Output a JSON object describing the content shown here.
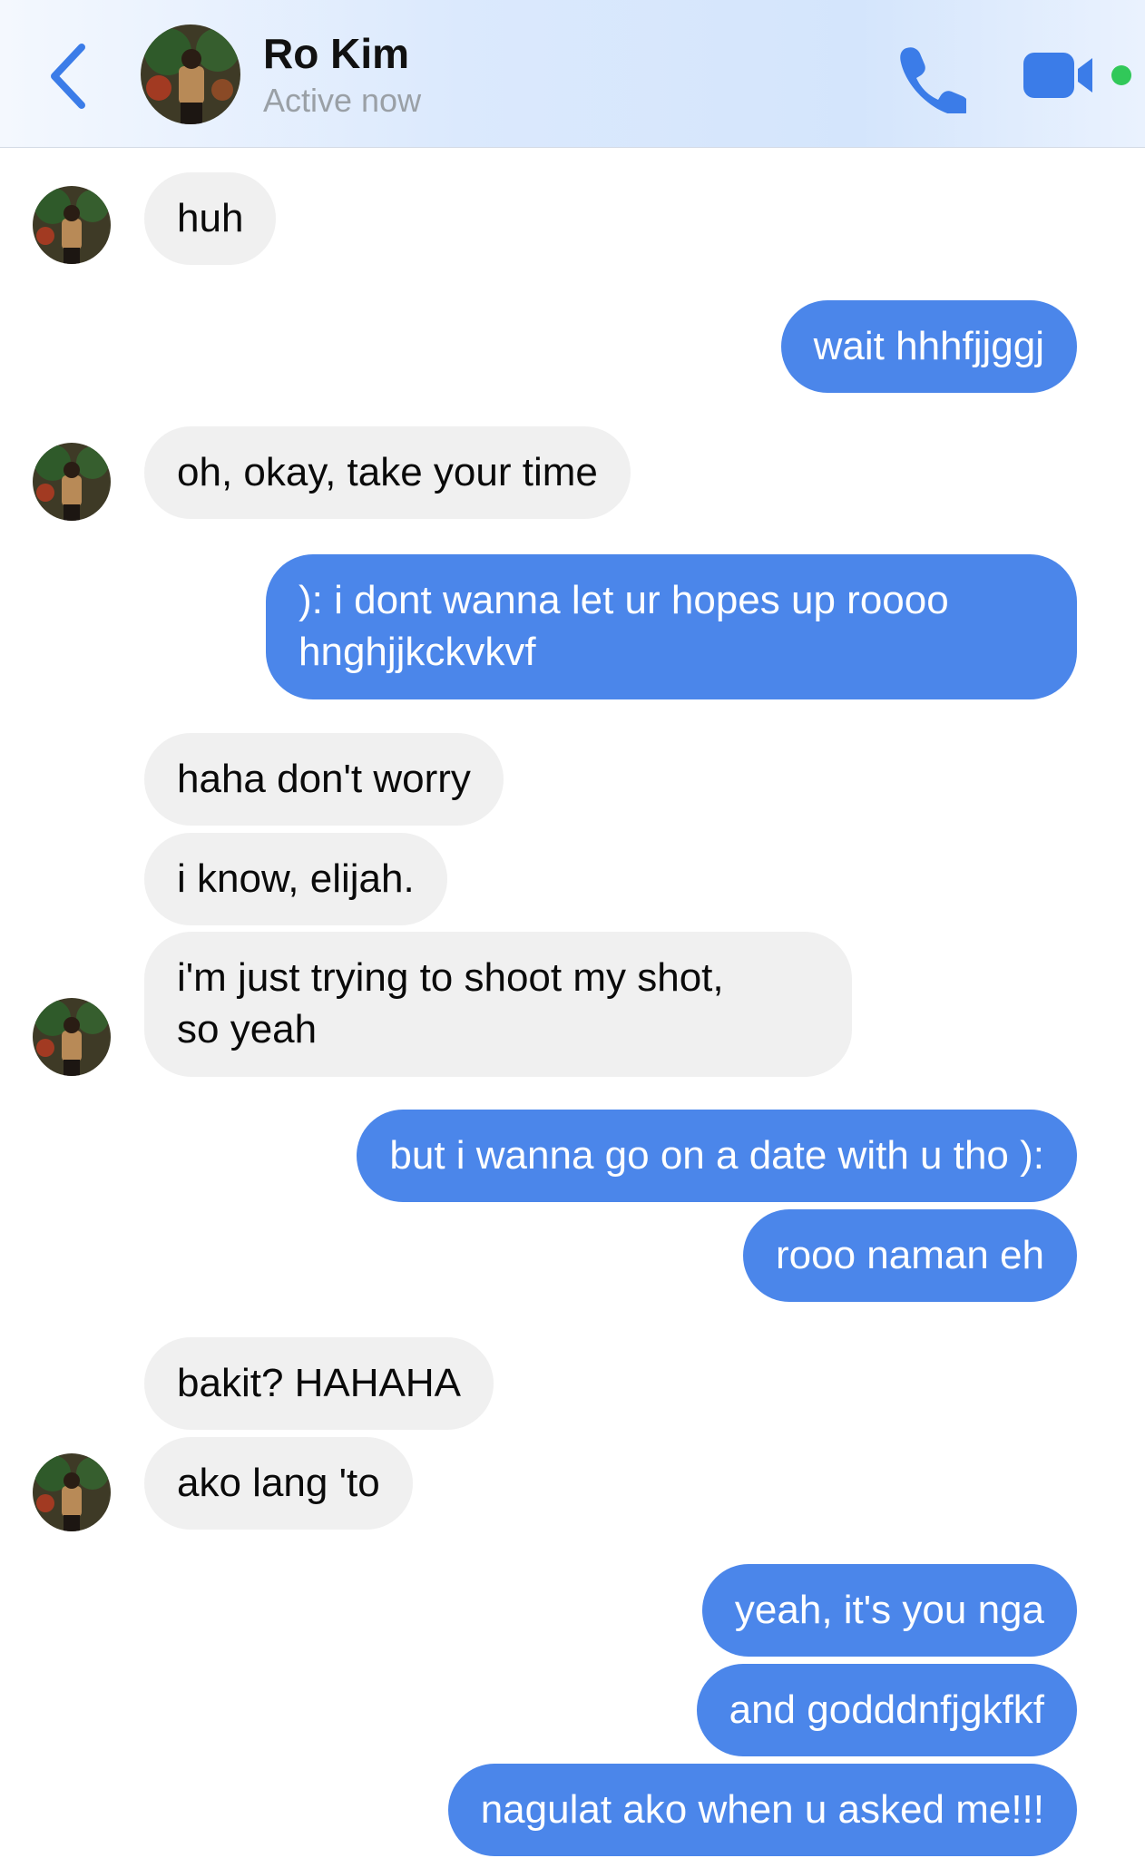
{
  "header": {
    "contact_name": "Ro Kim",
    "status": "Active now",
    "icons": [
      "back-chevron-icon",
      "avatar",
      "phone-icon",
      "video-camera-icon",
      "online-dot"
    ],
    "colors": {
      "accent": "#4b86ea",
      "online": "#31c859"
    }
  },
  "messages": [
    {
      "from": "them",
      "lines": [
        "huh"
      ]
    },
    {
      "from": "me",
      "lines": [
        "wait hhhfjjggj"
      ]
    },
    {
      "from": "them",
      "lines": [
        "oh, okay, take your time"
      ]
    },
    {
      "from": "me",
      "lines": [
        "): i dont wanna let ur hopes up roooo",
        "hnghjjkckvkvf"
      ]
    },
    {
      "from": "them",
      "lines": [
        "haha don't worry"
      ]
    },
    {
      "from": "them",
      "lines": [
        "i know, elijah."
      ]
    },
    {
      "from": "them",
      "lines": [
        "i'm just trying to shoot my shot,",
        "so yeah"
      ]
    },
    {
      "from": "me",
      "lines": [
        "but i wanna go on a date with u tho ):"
      ]
    },
    {
      "from": "me",
      "lines": [
        "rooo naman eh"
      ]
    },
    {
      "from": "them",
      "lines": [
        "bakit? HAHAHA"
      ]
    },
    {
      "from": "them",
      "lines": [
        "ako lang 'to"
      ]
    },
    {
      "from": "me",
      "lines": [
        "yeah, it's you nga"
      ]
    },
    {
      "from": "me",
      "lines": [
        "and godddnfjgkfkf"
      ]
    },
    {
      "from": "me",
      "lines": [
        "nagulat ako when u asked me!!!"
      ]
    }
  ]
}
